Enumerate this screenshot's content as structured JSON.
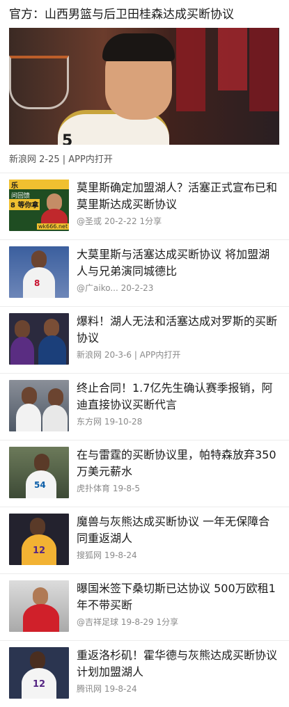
{
  "top_news": {
    "title": "官方：山西男篮与后卫田桂森达成买断协议",
    "meta": "新浪网 2-25 | APP内打开",
    "jersey_number": "5"
  },
  "thumb1_text": {
    "line1": "乐",
    "line2": "问回馈",
    "line3": "8 等你拿",
    "site": "wk666.net"
  },
  "articles": [
    {
      "title": "莫里斯确定加盟湖人？活塞正式宣布已和莫里斯达成买断协议",
      "meta": "@圣或 20-2-22 1分享",
      "jersey": ""
    },
    {
      "title": "大莫里斯与活塞达成买断协议 将加盟湖人与兄弟演同城德比",
      "meta": "@广aiko... 20-2-23",
      "jersey": "8"
    },
    {
      "title": "爆料！湖人无法和活塞达成对罗斯的买断协议",
      "meta": "新浪网 20-3-6 | APP内打开",
      "jersey": ""
    },
    {
      "title": "终止合同！1.7亿先生确认赛季报销，阿迪直接协议买断代言",
      "meta": "东方网 19-10-28",
      "jersey": ""
    },
    {
      "title": "在与雷霆的买断协议里，帕特森放弃350万美元薪水",
      "meta": "虎扑体育 19-8-5",
      "jersey": "54"
    },
    {
      "title": "魔兽与灰熊达成买断协议 一年无保障合同重返湖人",
      "meta": "搜狐网 19-8-24",
      "jersey": "12"
    },
    {
      "title": "曝国米签下桑切斯已达协议 500万欧租1年不带买断",
      "meta": "@吉祥足球 19-8-29 1分享",
      "jersey": ""
    },
    {
      "title": "重返洛杉矶！霍华德与灰熊达成买断协议 计划加盟湖人",
      "meta": "腾讯网 19-8-24",
      "jersey": "12"
    }
  ],
  "thumb_colors": [
    "#2d6b2a",
    "#3b5f9e",
    "#3a3552",
    "#5e6a7a",
    "#5a6b4a",
    "#2b2b38",
    "#c9c9c9",
    "#2e3a5c"
  ]
}
